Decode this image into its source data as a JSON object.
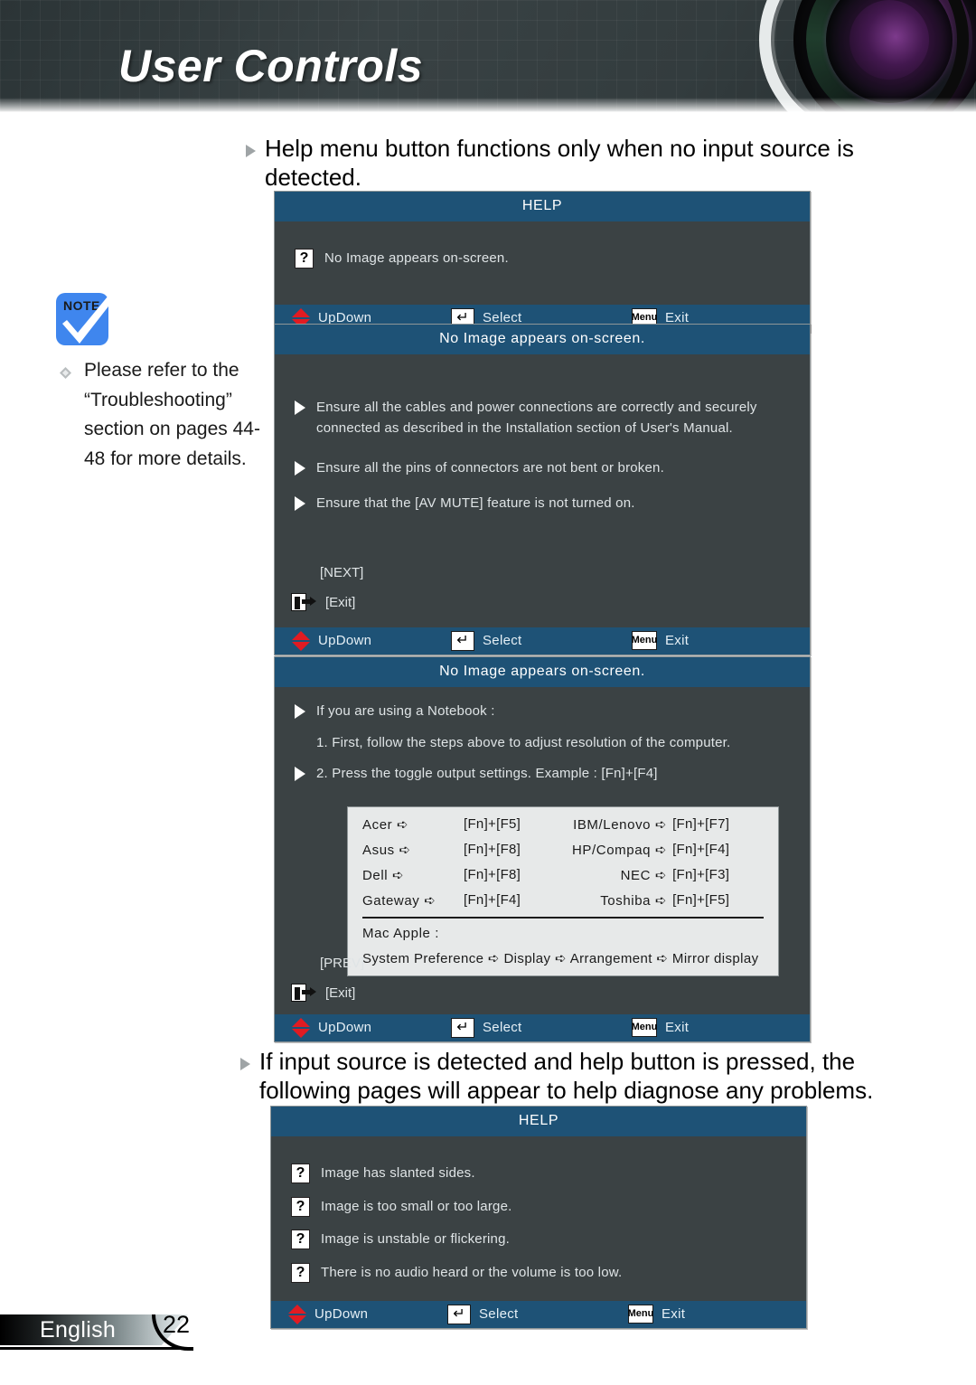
{
  "header": {
    "title": "User Controls",
    "lens_icon": "camera-lens-graphic"
  },
  "note": {
    "icon_label": "NOTE",
    "icon_name": "note-checkmark-icon",
    "text": "Please refer to the “Troubleshooting” section on pages 44-48 for more details."
  },
  "bullets": {
    "first": "Help menu button functions only when no input source is detected.",
    "second": "If input source is detected and help button is pressed, the following pages will appear to help diagnose any problems."
  },
  "footer_bar": {
    "updown_label": "UpDown",
    "select_label": "Select",
    "exit_label": "Exit",
    "menu_key_label": "Menu",
    "enter_key_glyph": "↵",
    "updown_icon": "up-down-arrow-icon",
    "menu_icon": "menu-key-icon",
    "enter_icon": "enter-key-icon"
  },
  "dialog1": {
    "title": "HELP",
    "items": [
      "No Image appears on-screen."
    ]
  },
  "dialog2": {
    "title": "No Image appears on-screen.",
    "items": [
      "Ensure all the cables and power connections are correctly and securely connected as described in the Installation section of User's Manual.",
      "Ensure all the pins of connectors are not bent or broken.",
      "Ensure that the [AV MUTE] feature is not turned on."
    ],
    "nav_next": "[NEXT]",
    "nav_exit": "[Exit]"
  },
  "dialog3": {
    "title": "No Image appears on-screen.",
    "intro": "If you are using a Notebook :",
    "step1": "1. First, follow the steps above to adjust resolution of the computer.",
    "step2": "2. Press the toggle output settings. Example : [Fn]+[F4]",
    "keytable": {
      "left": [
        {
          "brand": "Acer",
          "keys": "[Fn]+[F5]"
        },
        {
          "brand": "Asus",
          "keys": "[Fn]+[F8]"
        },
        {
          "brand": "Dell",
          "keys": "[Fn]+[F8]"
        },
        {
          "brand": "Gateway",
          "keys": "[Fn]+[F4]"
        }
      ],
      "right": [
        {
          "brand": "IBM/Lenovo",
          "keys": "[Fn]+[F7]"
        },
        {
          "brand": "HP/Compaq",
          "keys": "[Fn]+[F4]"
        },
        {
          "brand": "NEC",
          "keys": "[Fn]+[F3]"
        },
        {
          "brand": "Toshiba",
          "keys": "[Fn]+[F5]"
        }
      ],
      "mac_label": "Mac Apple :",
      "mac_flow": "System Preference ➪ Display ➪ Arrangement ➪ Mirror display",
      "arrow_glyph": "➪"
    },
    "nav_prev": "[PREV]",
    "nav_exit": "[Exit]"
  },
  "dialog4": {
    "title": "HELP",
    "items": [
      "Image has slanted sides.",
      "Image is too small or too large.",
      "Image is unstable or flickering.",
      "There is no audio heard or the volume is too low."
    ]
  },
  "page_footer": {
    "language": "English",
    "page_number": "22"
  },
  "colors": {
    "osd_header": "#1e5276",
    "osd_body": "#3b4244",
    "banner": "#343d3f",
    "note_blue": "#3f86ee",
    "accent_red": "#e11b22"
  }
}
